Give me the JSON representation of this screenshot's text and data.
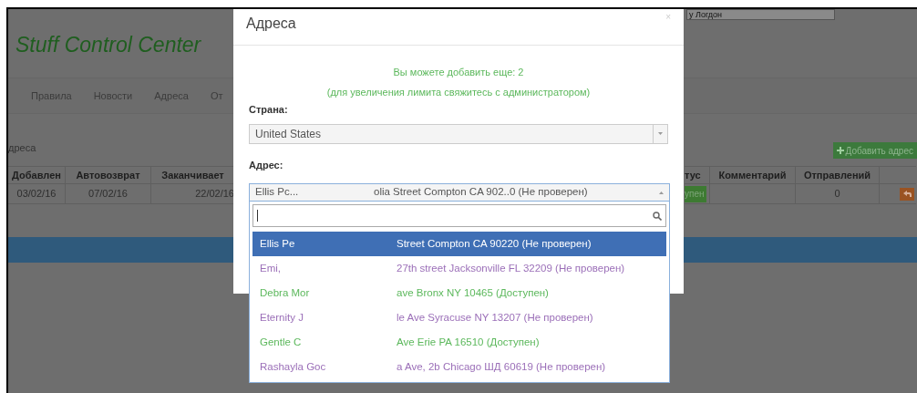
{
  "app": {
    "title": "Stuff Control Center",
    "top_field": "у Логдон"
  },
  "nav": [
    {
      "label": "Правила"
    },
    {
      "label": "Новости"
    },
    {
      "label": "Адреса"
    },
    {
      "label": "От"
    }
  ],
  "section_title": "дреса",
  "add_button": "Добавить адрес",
  "table": {
    "left_columns": [
      "Добавлен",
      "Автовозврат",
      "Заканчивает"
    ],
    "right_columns": [
      "тус",
      "Комментарий",
      "Отправлений"
    ],
    "rows": [
      {
        "left": [
          "03/02/16",
          "07/02/16",
          "22/02/16"
        ],
        "status": "упен",
        "sent": "0"
      }
    ]
  },
  "modal": {
    "title": "Адреса",
    "close": "×",
    "notice": "Вы можете добавить еще: 2",
    "notice_hint": "(для увеличения лимита свяжитесь с администратором)",
    "country_label": "Страна:",
    "country": "United States",
    "address_label": "Адрес:",
    "address_value": {
      "start": "Ellis Pc...",
      "end": "olia Street Compton CA 902..0 (Не проверен)"
    },
    "options": [
      {
        "start": "Ellis Pe",
        "end": "Street Compton CA 90220 (Не проверен)",
        "selected": true
      },
      {
        "start": "Emi,",
        "end": "27th street Jacksonville FL 32209 (Не проверен)",
        "color": "#9b6fb8",
        "selected": false
      },
      {
        "start": "Debra Mor",
        "end": "ave Bronx NY 10465 (Доступен)",
        "color": "#5cb85c",
        "selected": false
      },
      {
        "start": "Eternity J",
        "end": "le Ave Syracuse NY 13207 (Не проверен)",
        "color": "#9b6fb8",
        "selected": false
      },
      {
        "start": "Gentle C",
        "end": "Ave Erie PA 16510 (Доступен)",
        "color": "#5cb85c",
        "selected": false
      },
      {
        "start": "Rashayla Goc",
        "end": "a Ave, 2b Chicago ШД 60619 (Не проверен)",
        "color": "#9b6fb8",
        "selected": false
      }
    ]
  }
}
